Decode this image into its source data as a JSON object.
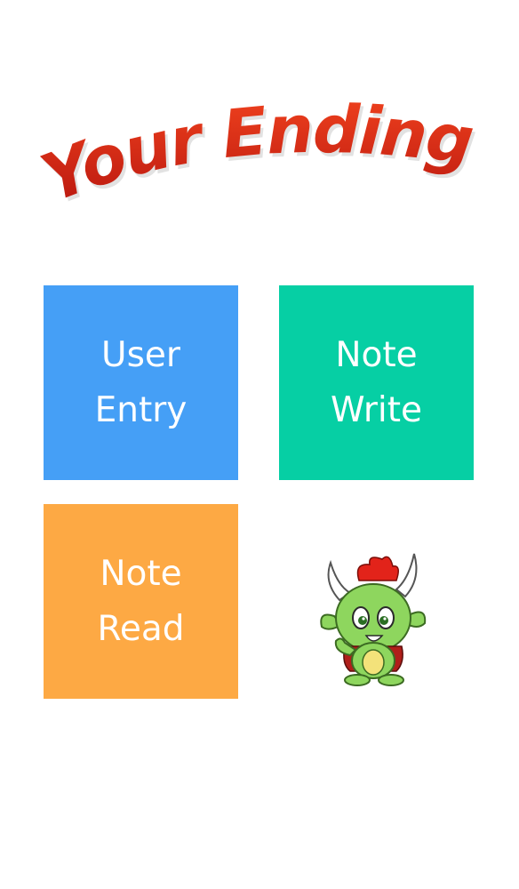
{
  "app": {
    "logo_text": "Your Ending"
  },
  "menu": {
    "tiles": [
      {
        "line1": "User",
        "line2": "Entry",
        "color": "#459FF6"
      },
      {
        "line1": "Note",
        "line2": "Write",
        "color": "#06CFA4"
      },
      {
        "line1": "Note",
        "line2": "Read",
        "color": "#FDA944"
      }
    ]
  },
  "colors": {
    "logo_red": "#C81A12",
    "logo_orange": "#E8361C",
    "background": "#FFFFFF"
  },
  "mascot": {
    "icon": "green-dragon-mascot-icon"
  }
}
